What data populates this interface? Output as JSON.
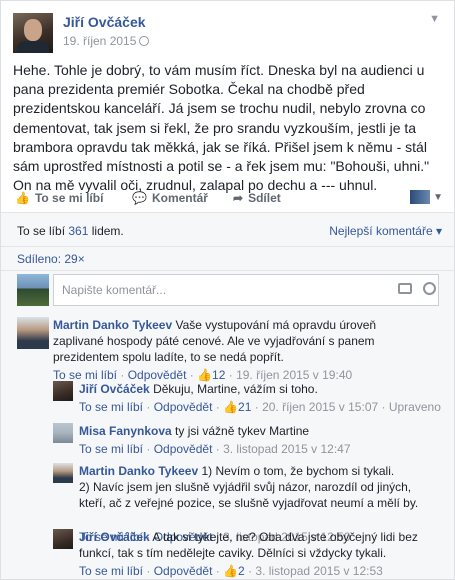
{
  "post": {
    "author": "Jiří Ovčáček",
    "date": "19. říjen 2015",
    "menu_icon": "chevron-down-icon",
    "text": "Hehe. Tohle je dobrý, to vám musím říct. Dneska byl na audienci u pana prezidenta premiér Sobotka. Čekal na chodbě před prezidentskou kanceláří. Já jsem se trochu nudil, nebylo zrovna co dementovat, tak jsem si řekl, že pro srandu vyzkouším, jestli je ta brambora opravdu tak měkká, jak se říká. Přišel jsem k němu - stál sám uprostřed místnosti a potil se - a řek jsem mu: \"Bohouši, uhni.\" On na mě vyvalil oči, zrudnul, zalapal po dechu a --- uhnul."
  },
  "actions": {
    "like": "To se mi líbí",
    "comment": "Komentář",
    "share": "Sdílet"
  },
  "likes": {
    "prefix": "To se líbí",
    "count": "361",
    "suffix": "lidem.",
    "sort": "Nejlepší komentáře ▾"
  },
  "shares": {
    "text": "Sdíleno: 29×"
  },
  "composer": {
    "placeholder": "Napište komentář..."
  },
  "comments": [
    {
      "name": "Martin Danko Tykeev",
      "text": "Vaše vystupování má opravdu úroveň zaplivané hospody páté cenové. Ale ve vyjadřování s panem prezidentem spolu ladíte, to se nedá popřít.",
      "like": "To se mi líbí",
      "reply": "Odpovědět",
      "likes": "12",
      "time": "19. říjen 2015 v 19:40"
    },
    {
      "name": "Jiří Ovčáček",
      "text": "Děkuju, Martine, vážím si toho.",
      "like": "To se mi líbí",
      "reply": "Odpovědět",
      "likes": "21",
      "time": "20. říjen 2015 v 15:07",
      "extra": "Upraveno"
    },
    {
      "name": "Misa Fanynkova",
      "text": "ty jsi vážně tykev Martine",
      "like": "To se mi líbí",
      "reply": "Odpovědět",
      "time": "3. listopad 2015 v 12:47"
    },
    {
      "name": "Martin Danko Tykeev",
      "text": "1) Nevím o tom, že bychom si tykali.",
      "text2": "2) Navíc jsem jen slušně vyjádřil svůj názor, narozdíl od jiných, kteří, ač z veřejné pozice, se slušně vyjadřovat neumí a mělí by.",
      "like": "To se mi líbí",
      "reply": "Odpovědět",
      "time": "3. listopad 2015 v 12:50"
    },
    {
      "name": "Jiří Ovčáček",
      "text": "A tak si tykejte, ne? Oba dva jste obyčejný lidi bez funkcí, tak s tím nedělejte caviky. Dělníci si vždycky tykali.",
      "like": "To se mi líbí",
      "reply": "Odpovědět",
      "likes": "2",
      "time": "3. listopad 2015 v 12:53"
    }
  ]
}
